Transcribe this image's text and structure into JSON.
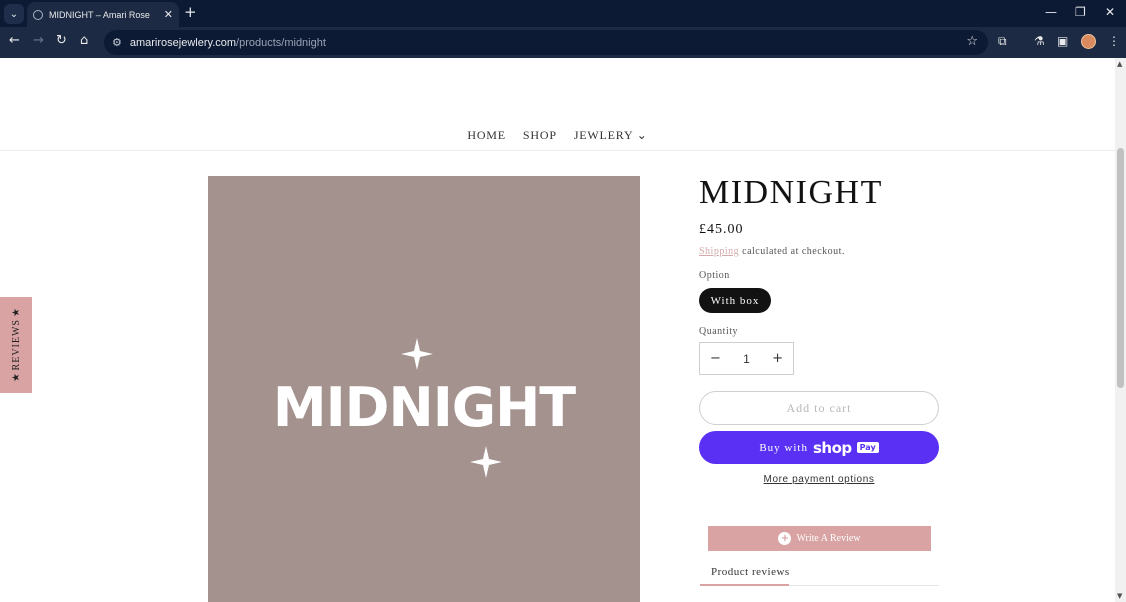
{
  "browser": {
    "tab_title": "MIDNIGHT – Amari Rose",
    "url_host": "amarirosejewlery.com",
    "url_path": "/products/midnight"
  },
  "site_nav": {
    "items": [
      "HOME",
      "SHOP",
      "JEWLERY ⌄"
    ]
  },
  "reviews_tab": {
    "label": "REVIEWS"
  },
  "product": {
    "image_text": "MIDNIGHT",
    "title": "MIDNIGHT",
    "price": "£45.00",
    "shipping_link": "Shipping",
    "shipping_rest": " calculated at checkout.",
    "option_label": "Option",
    "option_value": "With box",
    "quantity_label": "Quantity",
    "quantity_value": "1",
    "add_to_cart": "Add to cart",
    "buy_with": "Buy with",
    "shop_logo": "shop",
    "pay_logo": "Pay",
    "more_payment": "More payment options"
  },
  "reviews": {
    "write_review": "Write A Review",
    "tab_label": "Product reviews"
  },
  "colors": {
    "chrome_dark": "#0c1a33",
    "image_bg": "#a4928f",
    "accent_pink": "#d9a3a3",
    "shop_pay": "#5a31f4"
  }
}
